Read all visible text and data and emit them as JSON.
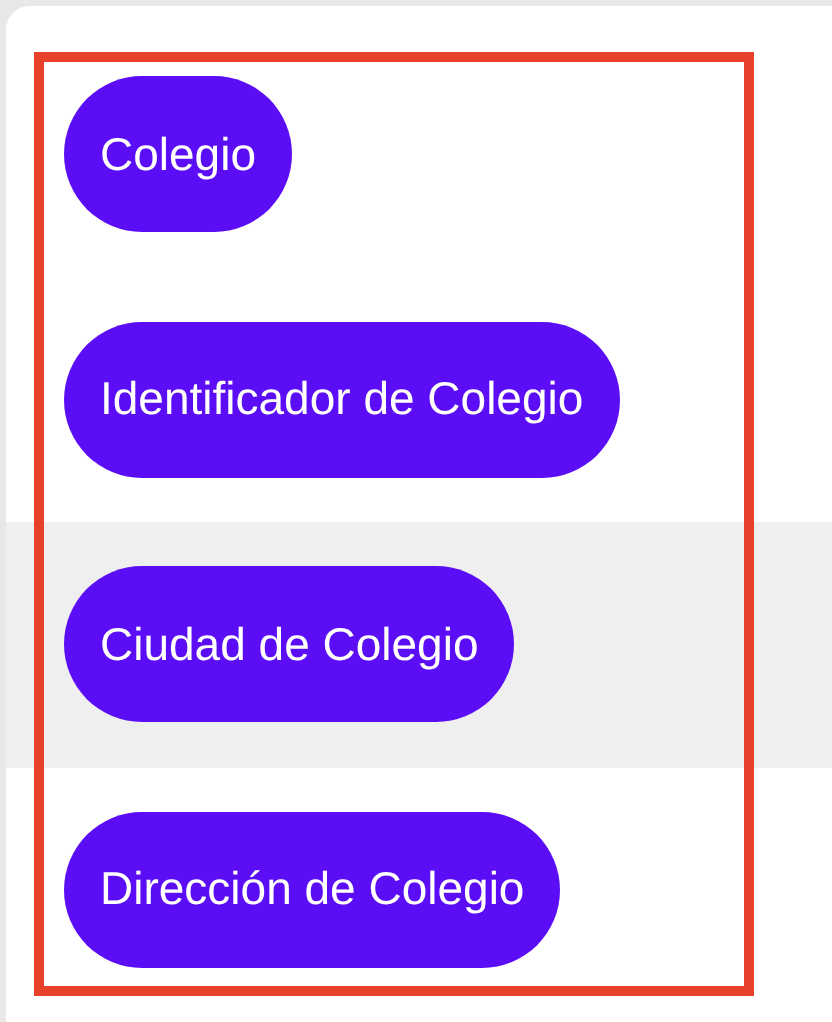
{
  "rows": [
    {
      "label": "Colegio",
      "selected": false
    },
    {
      "label": "Identificador de Colegio",
      "selected": false
    },
    {
      "label": "Ciudad de Colegio",
      "selected": true
    },
    {
      "label": "Dirección de Colegio",
      "selected": false
    }
  ]
}
